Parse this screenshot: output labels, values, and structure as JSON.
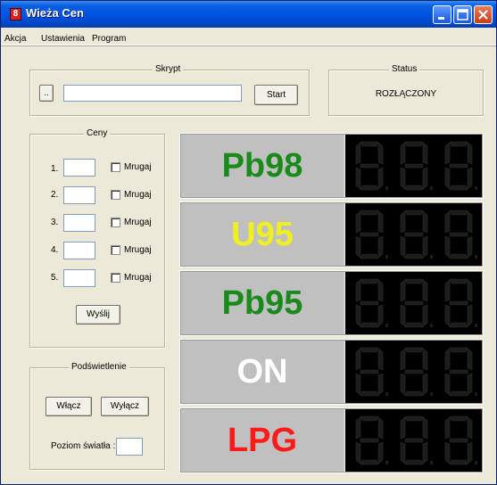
{
  "window": {
    "title": "Wieża Cen",
    "app_icon_glyph": "8",
    "controls": [
      "minimize-icon",
      "maximize-icon",
      "close-icon"
    ]
  },
  "menu": [
    "Akcja",
    "Ustawienia",
    "Program"
  ],
  "script_group": {
    "legend": "Skrypt",
    "browse_label": "..",
    "path_value": "",
    "start_label": "Start"
  },
  "status_group": {
    "legend": "Status",
    "value": "ROZŁĄCZONY"
  },
  "prices_group": {
    "legend": "Ceny",
    "rows": [
      {
        "index": "1.",
        "value": "",
        "checkbox_label": "Mrugaj",
        "checked": false
      },
      {
        "index": "2.",
        "value": "",
        "checkbox_label": "Mrugaj",
        "checked": false
      },
      {
        "index": "3.",
        "value": "",
        "checkbox_label": "Mrugaj",
        "checked": false
      },
      {
        "index": "4.",
        "value": "",
        "checkbox_label": "Mrugaj",
        "checked": false
      },
      {
        "index": "5.",
        "value": "",
        "checkbox_label": "Mrugaj",
        "checked": false
      }
    ],
    "send_label": "Wyślij"
  },
  "backlight_group": {
    "legend": "Podświetlenie",
    "on_label": "Włącz",
    "off_label": "Wyłącz",
    "light_level_label": "Poziom światła :",
    "light_level_value": ""
  },
  "fuel_board": [
    {
      "name": "Pb98",
      "color": "#1a8a1a"
    },
    {
      "name": "U95",
      "color": "#f0f020"
    },
    {
      "name": "Pb95",
      "color": "#1a8a1a"
    },
    {
      "name": "ON",
      "color": "#ffffff"
    },
    {
      "name": "LPG",
      "color": "#ff1a1a"
    }
  ],
  "colors": {
    "window_bg": "#ece9d8",
    "titlebar": "#0054e3",
    "display_bg": "#000000",
    "segment_off": "#1c1c1c",
    "label_bg": "#c0c0c0"
  }
}
